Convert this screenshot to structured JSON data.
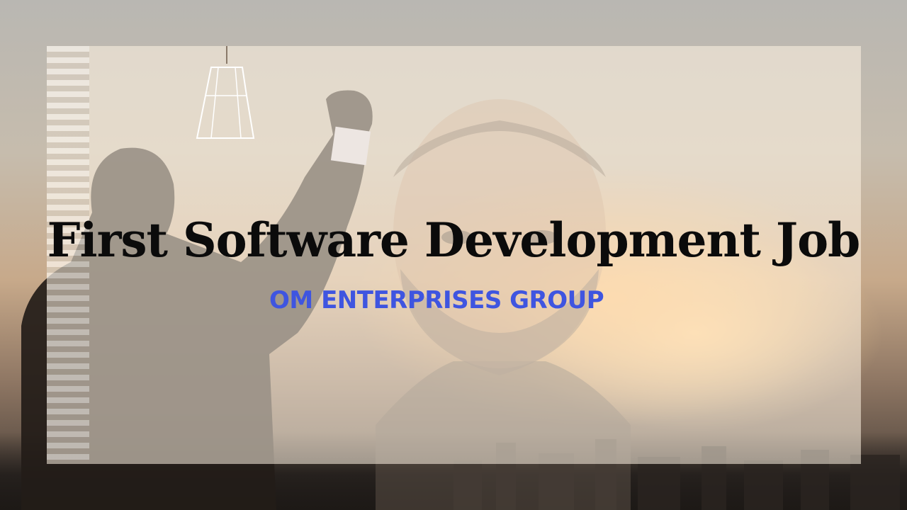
{
  "slide": {
    "title": "First Software Development Job",
    "subtitle": "OM ENTERPRISES GROUP"
  },
  "colors": {
    "title": "#0b0b0b",
    "subtitle": "#3f55e0",
    "panel": "#fff4e4"
  },
  "images": {
    "background": "sunset-city-skyline-photo",
    "left_figure": "man-raising-fist-silhouette",
    "center_figure": "bearded-man-portrait",
    "decor": "hanging-lamp"
  }
}
